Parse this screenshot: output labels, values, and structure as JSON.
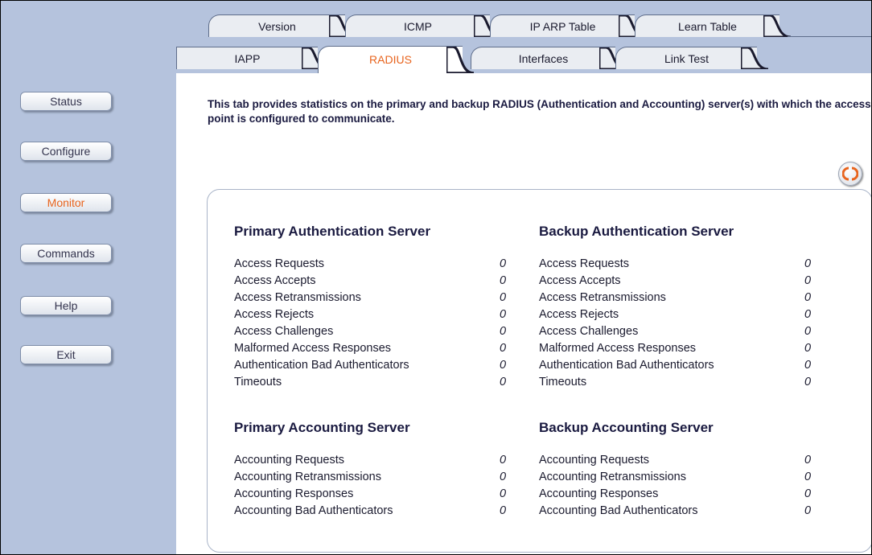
{
  "sidebar": {
    "buttons": [
      {
        "label": "Status",
        "active": false
      },
      {
        "label": "Configure",
        "active": false
      },
      {
        "label": "Monitor",
        "active": true
      },
      {
        "label": "Commands",
        "active": false
      },
      {
        "label": "Help",
        "active": false
      },
      {
        "label": "Exit",
        "active": false
      }
    ]
  },
  "tabs": {
    "row1": [
      "Version",
      "ICMP",
      "IP ARP Table",
      "Learn Table"
    ],
    "row2": [
      "IAPP",
      "RADIUS",
      "Interfaces",
      "Link Test"
    ],
    "active": "RADIUS"
  },
  "description": "This tab provides statistics on the primary and backup RADIUS (Authentication and Accounting) server(s) with which the access point is configured to communicate.",
  "refresh": {
    "icon": "refresh-icon"
  },
  "sections": {
    "primary_auth": {
      "title": "Primary Authentication Server",
      "rows": [
        {
          "label": "Access Requests",
          "value": "0"
        },
        {
          "label": "Access Accepts",
          "value": "0"
        },
        {
          "label": "Access Retransmissions",
          "value": "0"
        },
        {
          "label": "Access Rejects",
          "value": "0"
        },
        {
          "label": "Access Challenges",
          "value": "0"
        },
        {
          "label": "Malformed Access Responses",
          "value": "0"
        },
        {
          "label": "Authentication Bad Authenticators",
          "value": "0"
        },
        {
          "label": "Timeouts",
          "value": "0"
        }
      ]
    },
    "backup_auth": {
      "title": "Backup Authentication Server",
      "rows": [
        {
          "label": "Access Requests",
          "value": "0"
        },
        {
          "label": "Access Accepts",
          "value": "0"
        },
        {
          "label": "Access Retransmissions",
          "value": "0"
        },
        {
          "label": "Access Rejects",
          "value": "0"
        },
        {
          "label": "Access Challenges",
          "value": "0"
        },
        {
          "label": "Malformed Access Responses",
          "value": "0"
        },
        {
          "label": "Authentication Bad Authenticators",
          "value": "0"
        },
        {
          "label": "Timeouts",
          "value": "0"
        }
      ]
    },
    "primary_acct": {
      "title": "Primary Accounting Server",
      "rows": [
        {
          "label": "Accounting Requests",
          "value": "0"
        },
        {
          "label": "Accounting Retransmissions",
          "value": "0"
        },
        {
          "label": "Accounting Responses",
          "value": "0"
        },
        {
          "label": "Accounting Bad Authenticators",
          "value": "0"
        }
      ]
    },
    "backup_acct": {
      "title": "Backup Accounting Server",
      "rows": [
        {
          "label": "Accounting Requests",
          "value": "0"
        },
        {
          "label": "Accounting Retransmissions",
          "value": "0"
        },
        {
          "label": "Accounting Responses",
          "value": "0"
        },
        {
          "label": "Accounting Bad Authenticators",
          "value": "0"
        }
      ]
    }
  },
  "colors": {
    "sidebar_bg": "#b5c3dd",
    "active_accent": "#e8641e",
    "heading_text": "#1a1a40"
  }
}
